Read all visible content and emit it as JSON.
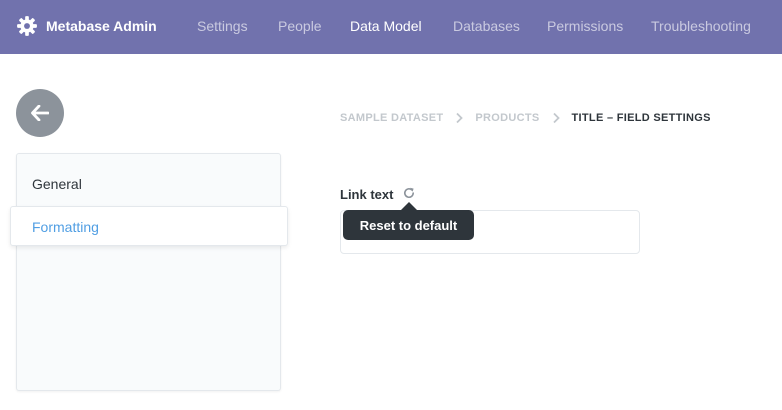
{
  "brand": {
    "label": "Metabase Admin",
    "icon": "gear-icon"
  },
  "nav": {
    "items": [
      {
        "label": "Settings",
        "active": false
      },
      {
        "label": "People",
        "active": false
      },
      {
        "label": "Data Model",
        "active": true
      },
      {
        "label": "Databases",
        "active": false
      },
      {
        "label": "Permissions",
        "active": false
      },
      {
        "label": "Troubleshooting",
        "active": false
      }
    ]
  },
  "breadcrumb": {
    "items": [
      "SAMPLE DATASET",
      "PRODUCTS",
      "TITLE – FIELD SETTINGS"
    ]
  },
  "sidebar": {
    "items": [
      {
        "label": "General",
        "selected": false
      },
      {
        "label": "Formatting",
        "selected": true
      }
    ]
  },
  "field": {
    "label": "Link text",
    "value": "",
    "reset_icon": "refresh-icon"
  },
  "tooltip": {
    "text": "Reset to default"
  },
  "colors": {
    "nav_bg": "#7172ad",
    "accent": "#509ee3",
    "tooltip_bg": "#2e353b",
    "back_button_bg": "#8c939b"
  }
}
